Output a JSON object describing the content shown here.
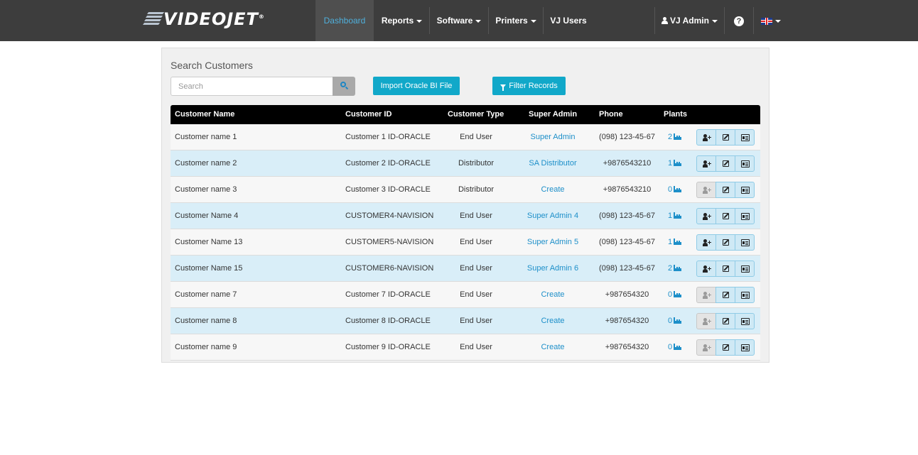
{
  "brand": {
    "name": "VIDEOJET",
    "mark": "®"
  },
  "nav": {
    "dashboard": "Dashboard",
    "reports": "Reports",
    "software": "Software",
    "printers": "Printers",
    "vj_users": "VJ Users",
    "user": "VJ Admin",
    "help": "?"
  },
  "page": {
    "title": "Search Customers",
    "search_placeholder": "Search",
    "import_button": "Import Oracle BI File",
    "filter_button": "Filter Records"
  },
  "table": {
    "headers": [
      "Customer Name",
      "Customer ID",
      "Customer Type",
      "Super Admin",
      "Phone",
      "Plants"
    ],
    "rows": [
      {
        "name": "Customer name 1",
        "id": "Customer 1 ID-ORACLE",
        "type": "End User",
        "admin": "Super Admin",
        "phone": "(098) 123-45-67",
        "plants": "2",
        "can_add_admin": true
      },
      {
        "name": "Customer name 2",
        "id": "Customer 2 ID-ORACLE",
        "type": "Distributor",
        "admin": "SA Distributor",
        "phone": "+9876543210",
        "plants": "1",
        "can_add_admin": true
      },
      {
        "name": "Customer name 3",
        "id": "Customer 3 ID-ORACLE",
        "type": "Distributor",
        "admin": "Create",
        "phone": "+9876543210",
        "plants": "0",
        "can_add_admin": false
      },
      {
        "name": "Customer Name 4",
        "id": "CUSTOMER4-NAVISION",
        "type": "End User",
        "admin": "Super Admin 4",
        "phone": "(098) 123-45-67",
        "plants": "1",
        "can_add_admin": true
      },
      {
        "name": "Customer Name 13",
        "id": "CUSTOMER5-NAVISION",
        "type": "End User",
        "admin": "Super Admin 5",
        "phone": "(098) 123-45-67",
        "plants": "1",
        "can_add_admin": true
      },
      {
        "name": "Customer Name 15",
        "id": "CUSTOMER6-NAVISION",
        "type": "End User",
        "admin": "Super Admin 6",
        "phone": "(098) 123-45-67",
        "plants": "2",
        "can_add_admin": true
      },
      {
        "name": "Customer name 7",
        "id": "Customer 7 ID-ORACLE",
        "type": "End User",
        "admin": "Create",
        "phone": "+987654320",
        "plants": "0",
        "can_add_admin": false
      },
      {
        "name": "Customer name 8",
        "id": "Customer 8 ID-ORACLE",
        "type": "End User",
        "admin": "Create",
        "phone": "+987654320",
        "plants": "0",
        "can_add_admin": false
      },
      {
        "name": "Customer name 9",
        "id": "Customer 9 ID-ORACLE",
        "type": "End User",
        "admin": "Create",
        "phone": "+987654320",
        "plants": "0",
        "can_add_admin": false
      }
    ]
  },
  "colors": {
    "navbar": "#3d3d3d",
    "accent": "#11a8c9",
    "link": "#1d8fc9",
    "row_alt": "#d9eef8"
  }
}
